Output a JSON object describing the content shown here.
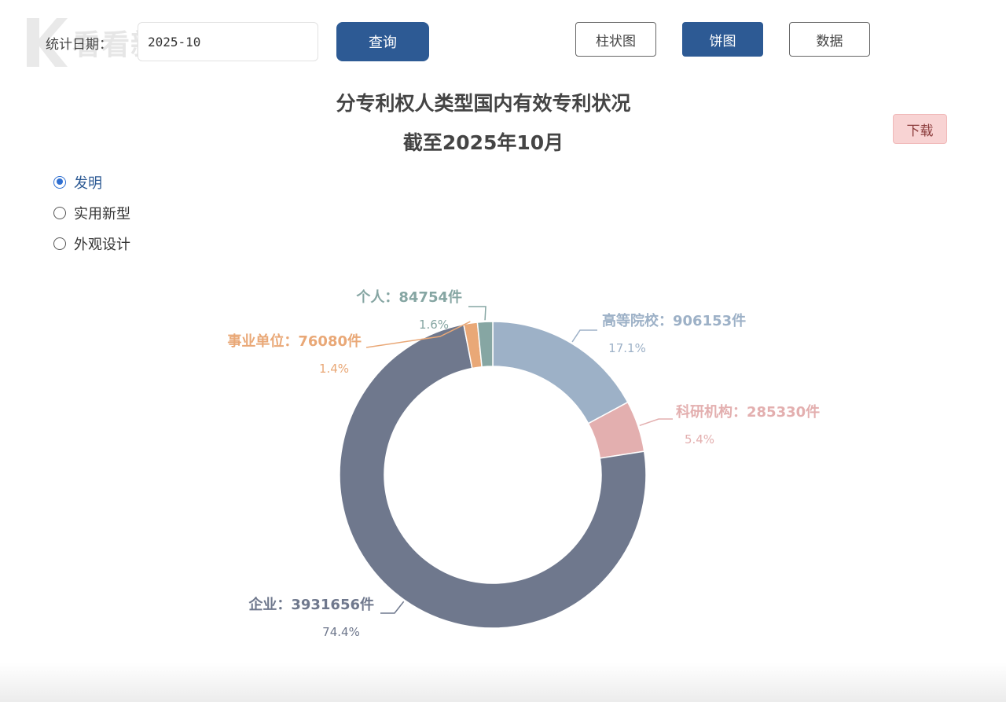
{
  "watermark": {
    "text": "看看新闻"
  },
  "filter": {
    "date_label": "统计日期：",
    "date_value": "2025-10",
    "query_label": "查询"
  },
  "view_buttons": {
    "bar_label": "柱状图",
    "pie_label": "饼图",
    "data_label": "数据"
  },
  "download_label": "下载",
  "patent_types": [
    {
      "label": "发明",
      "checked": true
    },
    {
      "label": "实用新型",
      "checked": false
    },
    {
      "label": "外观设计",
      "checked": false
    }
  ],
  "colors": {
    "primary": "#2d5a94",
    "download_bg": "#f8d3d3"
  },
  "chart_data": {
    "type": "pie",
    "variant": "donut",
    "title": "分专利权人类型国内有效专利状况",
    "subtitle": "截至2025年10月",
    "unit": "件",
    "legend": "none",
    "slices": [
      {
        "name": "高等院校",
        "value": 906153,
        "percent": "17.1%",
        "color": "#9db1c7"
      },
      {
        "name": "科研机构",
        "value": 285330,
        "percent": "5.4%",
        "color": "#e3afaf"
      },
      {
        "name": "企业",
        "value": 3931656,
        "percent": "74.4%",
        "color": "#6f788d"
      },
      {
        "name": "事业单位",
        "value": 76080,
        "percent": "1.4%",
        "color": "#e9a877"
      },
      {
        "name": "个人",
        "value": 84754,
        "percent": "1.6%",
        "color": "#86a6a3"
      }
    ]
  }
}
